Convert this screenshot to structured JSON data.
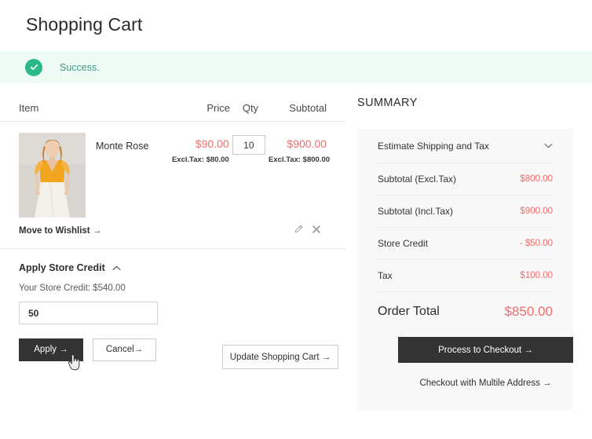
{
  "page": {
    "title": "Shopping Cart"
  },
  "notification": {
    "icon": "check-circle-icon",
    "message": "Success."
  },
  "cart": {
    "columns": {
      "item": "Item",
      "price": "Price",
      "qty": "Qty",
      "subtotal": "Subtotal"
    },
    "items": [
      {
        "name": "Monte Rose",
        "price": "$90.00",
        "price_excl_tax": "Excl.Tax: $80.00",
        "qty": "10",
        "subtotal": "$900.00",
        "subtotal_excl_tax": "Excl.Tax: $800.00",
        "edit_icon": "pencil-icon",
        "remove_icon": "close-x-icon"
      }
    ],
    "wishlist_link": "Move to Wishlist →",
    "update_button": "Update Shopping Cart →"
  },
  "store_credit": {
    "heading": "Apply Store Credit",
    "toggle_icon": "caret-up-icon",
    "balance_label": "Your Store Credit: $540.00",
    "input_value": "50",
    "input_placeholder": "",
    "apply_button": "Apply →",
    "cancel_button": "Cancel→"
  },
  "summary": {
    "heading": "SUMMARY",
    "shipping_row": {
      "label": "Estimate Shipping and Tax",
      "icon": "chevron-down-icon"
    },
    "rows": [
      {
        "label": "Subtotal (Excl.Tax)",
        "value": "$800.00"
      },
      {
        "label": "Subtotal (Incl.Tax)",
        "value": "$900.00"
      },
      {
        "label": "Store Credit",
        "value": "- $50.00"
      },
      {
        "label": "Tax",
        "value": "$100.00"
      }
    ],
    "total": {
      "label": "Order Total",
      "value": "$850.00"
    },
    "checkout_button": "Process to Checkout →",
    "multi_address_link": "Checkout with Multile Address →"
  },
  "colors": {
    "accent_price": "#f26d6d",
    "success_bg": "#effbf5",
    "success_fg": "#3a9c7d",
    "success_icon": "#2bb98a",
    "dark_button": "#333333",
    "panel_bg": "#f8f8f8"
  }
}
